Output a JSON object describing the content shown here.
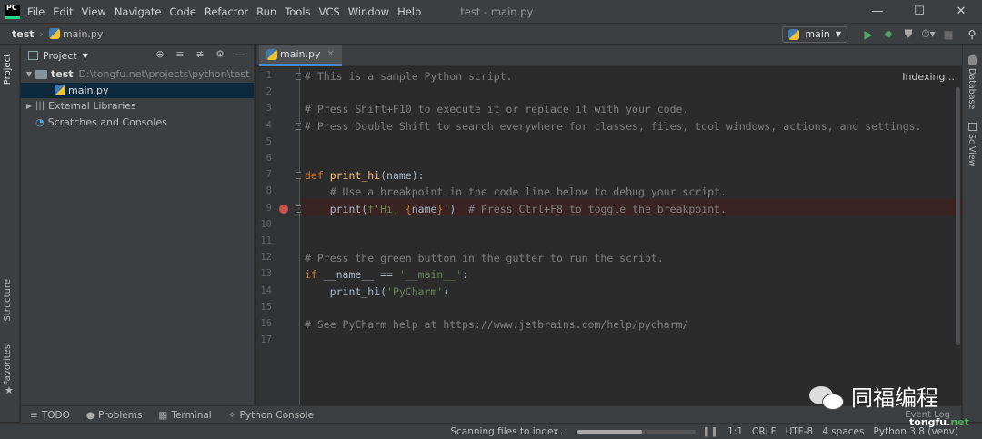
{
  "menubar": {
    "logo": "PC",
    "items": [
      "File",
      "Edit",
      "View",
      "Navigate",
      "Code",
      "Refactor",
      "Run",
      "Tools",
      "VCS",
      "Window",
      "Help"
    ],
    "window_title": "test - main.py"
  },
  "navbar": {
    "project": "test",
    "file": "main.py",
    "run_config": "main"
  },
  "left_tabs": {
    "project": "Project",
    "structure": "Structure",
    "favorites": "Favorites"
  },
  "right_tabs": {
    "database": "Database",
    "sciview": "SciView"
  },
  "project_panel": {
    "title": "Project",
    "root": "test",
    "root_path": "D:\\tongfu.net\\projects\\python\\test",
    "file": "main.py",
    "external": "External Libraries",
    "scratches": "Scratches and Consoles"
  },
  "editor": {
    "tab": "main.py",
    "indexing": "Indexing...",
    "breakpoint_line": 9
  },
  "code_lines": [
    [
      [
        "cm",
        "# This is a sample Python script."
      ]
    ],
    [],
    [
      [
        "cm",
        "# Press Shift+F10 to execute it or replace it with your code."
      ]
    ],
    [
      [
        "cm",
        "# Press Double Shift to search everywhere for classes, files, tool windows, actions, and settings."
      ]
    ],
    [],
    [],
    [
      [
        "kw",
        "def "
      ],
      [
        "fn",
        "print_hi"
      ],
      [
        "nm",
        "(name):"
      ]
    ],
    [
      [
        "nm",
        "    "
      ],
      [
        "cm",
        "# Use a breakpoint in the code line below to debug your script."
      ]
    ],
    [
      [
        "nm",
        "    print("
      ],
      [
        "st",
        "f'Hi, "
      ],
      [
        "kw",
        "{"
      ],
      [
        "nm",
        "name"
      ],
      [
        "kw",
        "}"
      ],
      [
        "st",
        "'"
      ],
      [
        "nm",
        ")  "
      ],
      [
        "cm",
        "# Press Ctrl+F8 to toggle the breakpoint."
      ]
    ],
    [],
    [],
    [
      [
        "cm",
        "# Press the green button in the gutter to run the script."
      ]
    ],
    [
      [
        "kw",
        "if "
      ],
      [
        "nm",
        "__name__ == "
      ],
      [
        "st",
        "'__main__'"
      ],
      [
        "nm",
        ":"
      ]
    ],
    [
      [
        "nm",
        "    print_hi("
      ],
      [
        "st",
        "'PyCharm'"
      ],
      [
        "nm",
        ")"
      ]
    ],
    [],
    [
      [
        "cm",
        "# See PyCharm help at https://www.jetbrains.com/help/pycharm/"
      ]
    ],
    []
  ],
  "bottom_tabs": [
    "TODO",
    "Problems",
    "Terminal",
    "Python Console"
  ],
  "status": {
    "scanning": "Scanning files to index...",
    "progress": 0.55,
    "position": "1:1",
    "line_sep": "CRLF",
    "encoding": "UTF-8",
    "indent": "4 spaces",
    "interpreter": "Python 3.8 (venv)",
    "event_log": "Event Log"
  },
  "watermark": {
    "name": "同福编程",
    "site_prefix": "tongfu.",
    "site_suffix": "net"
  },
  "colors": {
    "comment": "#808080",
    "keyword": "#cc7832",
    "function": "#ffc66d",
    "string": "#6a8759",
    "breakpoint": "#c75450"
  }
}
